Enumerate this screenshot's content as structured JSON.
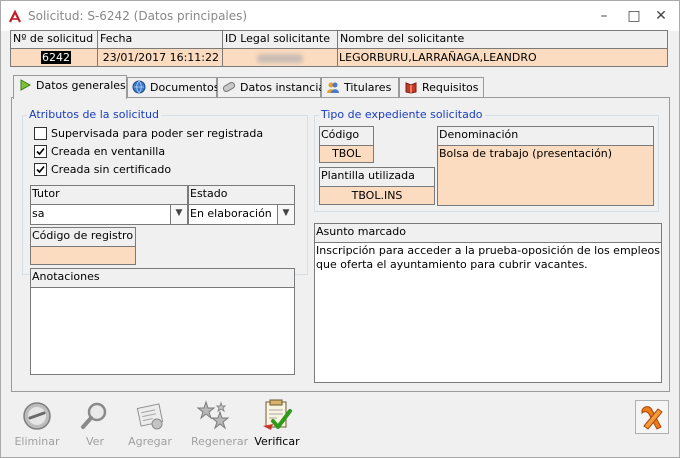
{
  "window": {
    "title": "Solicitud: S-6242 (Datos principales)",
    "controls": {
      "minimize": "–",
      "maximize": "□",
      "close": "✕"
    }
  },
  "header": {
    "columns": [
      {
        "label": "Nº de solicitud",
        "value": "6242"
      },
      {
        "label": "Fecha",
        "value": "23/01/2017 16:11:22"
      },
      {
        "label": "ID Legal solicitante",
        "value": ""
      },
      {
        "label": "Nombre del solicitante",
        "value": "LEGORBURU,LARRAÑAGA,LEANDRO"
      }
    ]
  },
  "tabs": [
    {
      "label": "Datos generales",
      "icon": "play-icon"
    },
    {
      "label": "Documentos",
      "icon": "globe-icon"
    },
    {
      "label": "Datos instancia",
      "icon": "pill-icon"
    },
    {
      "label": "Titulares",
      "icon": "users-icon"
    },
    {
      "label": "Requisitos",
      "icon": "book-icon"
    }
  ],
  "atributos": {
    "title": "Atributos de la solicitud",
    "checks": [
      {
        "label": "Supervisada para poder ser registrada",
        "checked": false
      },
      {
        "label": "Creada en ventanilla",
        "checked": true
      },
      {
        "label": "Creada sin certificado",
        "checked": true
      }
    ]
  },
  "tutor": {
    "label": "Tutor",
    "value": "sa"
  },
  "estado": {
    "label": "Estado",
    "value": "En elaboración"
  },
  "codigo_registro": {
    "label": "Código de registro",
    "value": ""
  },
  "anotaciones": {
    "label": "Anotaciones",
    "value": ""
  },
  "tipo_expediente": {
    "title": "Tipo de expediente solicitado",
    "codigo": {
      "label": "Código",
      "value": "TBOL"
    },
    "denominacion": {
      "label": "Denominación",
      "value": "Bolsa de trabajo (presentación)"
    },
    "plantilla": {
      "label": "Plantilla utilizada",
      "value": "TBOL.INS"
    }
  },
  "asunto": {
    "label": "Asunto marcado",
    "text": "Inscripción para acceder a la prueba-oposición de los empleos que oferta el ayuntamiento para cubrir vacantes."
  },
  "toolbar": [
    {
      "label": "Eliminar",
      "enabled": false,
      "icon": "delete-icon"
    },
    {
      "label": "Ver",
      "enabled": false,
      "icon": "magnifier-icon"
    },
    {
      "label": "Agregar",
      "enabled": false,
      "icon": "add-document-icon"
    },
    {
      "label": "Regenerar",
      "enabled": false,
      "icon": "regenerate-icon"
    },
    {
      "label": "Verificar",
      "enabled": true,
      "icon": "verify-icon"
    }
  ],
  "exit_button": {
    "icon": "exit-icon"
  }
}
